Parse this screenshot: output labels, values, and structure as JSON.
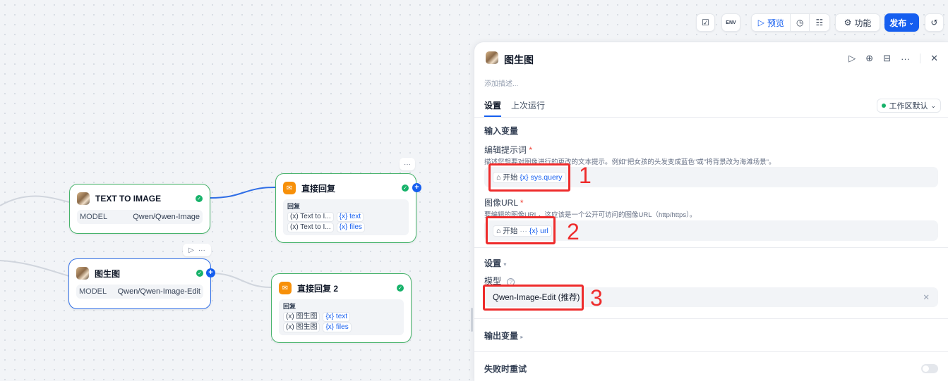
{
  "topbar": {
    "preview_label": "预览",
    "features_label": "功能",
    "publish_label": "发布",
    "env_badge": "ENV"
  },
  "nodes": {
    "text_to_image": {
      "title": "TEXT TO IMAGE",
      "model_label": "MODEL",
      "model_value": "Qwen/Qwen-Image"
    },
    "img2img": {
      "title": "图生图",
      "model_label": "MODEL",
      "model_value": "Qwen/Qwen-Image-Edit"
    },
    "answer1": {
      "title": "直接回复",
      "reply_label": "回复",
      "vars": [
        {
          "source": "Text to I...",
          "var": "text"
        },
        {
          "source": "Text to I...",
          "var": "files"
        }
      ]
    },
    "answer2": {
      "title": "直接回复 2",
      "reply_label": "回复",
      "vars": [
        {
          "source": "图生图",
          "var": "text"
        },
        {
          "source": "图生图",
          "var": "files"
        }
      ]
    }
  },
  "panel": {
    "title": "图生图",
    "description_placeholder": "添加描述...",
    "tabs": [
      "设置",
      "上次运行"
    ],
    "workspace_select": "工作区默认",
    "input_section": "输入变量",
    "fields": [
      {
        "label": "编辑提示词",
        "required": "*",
        "hint": "描述您想要对图像进行的更改的文本提示。例如\"把女孩的头发变成蓝色\"或\"将背景改为海滩场景\"。",
        "chip_node": "开始",
        "chip_sep": "",
        "chip_var": "sys.query"
      },
      {
        "label": "图像URL",
        "required": "*",
        "hint": "要编辑的图像URL，这应该是一个公开可访问的图像URL（http/https）。",
        "chip_node": "开始",
        "chip_sep": "···",
        "chip_var": "url"
      }
    ],
    "settings_section": "设置",
    "model_label": "模型",
    "model_value": "Qwen-Image-Edit (推荐)",
    "output_section": "输出变量",
    "retry_label": "失败时重试",
    "annotations": [
      "1",
      "2",
      "3"
    ]
  },
  "colors": {
    "accent": "#155eef",
    "success": "#17b26a",
    "annotation_red": "#ee2b2b",
    "answer_orange": "#f79009"
  }
}
